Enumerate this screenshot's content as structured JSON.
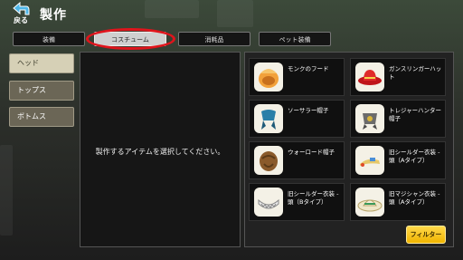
{
  "header": {
    "back_label": "戻る",
    "title": "製作"
  },
  "tabs": [
    {
      "label": "装備",
      "active": false
    },
    {
      "label": "コスチューム",
      "active": true
    },
    {
      "label": "消耗品",
      "active": false
    },
    {
      "label": "ペット装備",
      "active": false
    }
  ],
  "categories": [
    {
      "label": "ヘッド",
      "active": true
    },
    {
      "label": "トップス",
      "active": false
    },
    {
      "label": "ボトムス",
      "active": false
    }
  ],
  "center": {
    "message": "製作するアイテムを選択してください。"
  },
  "items": [
    {
      "name": "モンクのフード",
      "icon": "monk-hood-icon"
    },
    {
      "name": "ガンスリンガーハット",
      "icon": "gunslinger-hat-icon"
    },
    {
      "name": "ソーサラー帽子",
      "icon": "sorcerer-hat-icon"
    },
    {
      "name": "トレジャーハンター帽子",
      "icon": "treasure-hunter-hat-icon"
    },
    {
      "name": "ウォーロード帽子",
      "icon": "warlord-hat-icon"
    },
    {
      "name": "旧シールダー衣装 - 頭（Aタイプ）",
      "icon": "shielder-head-a-icon"
    },
    {
      "name": "旧シールダー衣装 - 頭（Bタイプ）",
      "icon": "shielder-head-b-icon"
    },
    {
      "name": "旧マジシャン衣装 - 頭（Aタイプ）",
      "icon": "magician-head-a-icon"
    }
  ],
  "filter": {
    "label": "フィルター"
  },
  "colors": {
    "highlight": "#e0141c",
    "filter_button": "#f0b400",
    "active_tab": "#cfcfcf"
  }
}
